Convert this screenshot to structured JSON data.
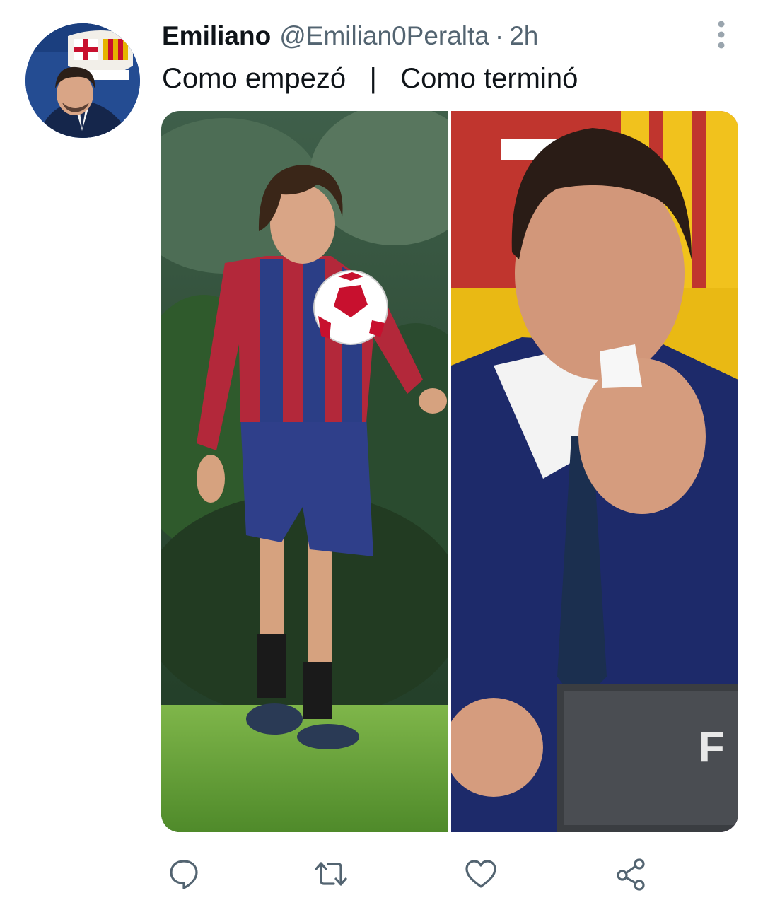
{
  "tweet": {
    "author": {
      "display_name": "Emiliano",
      "handle": "@Emilian0Peralta",
      "avatar_icon": "profile-photo-crest-avatar"
    },
    "separator": "·",
    "timestamp": "2h",
    "text": "Como empezó   |   Como terminó",
    "media": [
      {
        "position": "left",
        "description_icon": "young-player-juggling-ball-photo"
      },
      {
        "position": "right",
        "description_icon": "player-crying-press-conference-photo"
      }
    ]
  },
  "actions": [
    {
      "name": "reply",
      "icon": "reply-icon"
    },
    {
      "name": "retweet",
      "icon": "retweet-icon"
    },
    {
      "name": "like",
      "icon": "heart-icon"
    },
    {
      "name": "share",
      "icon": "share-icon"
    }
  ],
  "colors": {
    "text_primary": "#0f1419",
    "text_secondary": "#536471",
    "icon": "#536471",
    "background": "#ffffff"
  }
}
